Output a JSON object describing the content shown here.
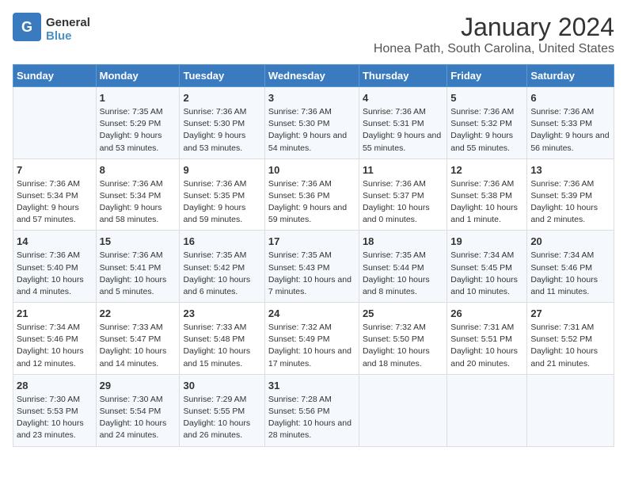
{
  "logo": {
    "line1": "General",
    "line2": "Blue"
  },
  "title": "January 2024",
  "subtitle": "Honea Path, South Carolina, United States",
  "weekdays": [
    "Sunday",
    "Monday",
    "Tuesday",
    "Wednesday",
    "Thursday",
    "Friday",
    "Saturday"
  ],
  "weeks": [
    [
      {
        "day": "",
        "sunrise": "",
        "sunset": "",
        "daylight": ""
      },
      {
        "day": "1",
        "sunrise": "Sunrise: 7:35 AM",
        "sunset": "Sunset: 5:29 PM",
        "daylight": "Daylight: 9 hours and 53 minutes."
      },
      {
        "day": "2",
        "sunrise": "Sunrise: 7:36 AM",
        "sunset": "Sunset: 5:30 PM",
        "daylight": "Daylight: 9 hours and 53 minutes."
      },
      {
        "day": "3",
        "sunrise": "Sunrise: 7:36 AM",
        "sunset": "Sunset: 5:30 PM",
        "daylight": "Daylight: 9 hours and 54 minutes."
      },
      {
        "day": "4",
        "sunrise": "Sunrise: 7:36 AM",
        "sunset": "Sunset: 5:31 PM",
        "daylight": "Daylight: 9 hours and 55 minutes."
      },
      {
        "day": "5",
        "sunrise": "Sunrise: 7:36 AM",
        "sunset": "Sunset: 5:32 PM",
        "daylight": "Daylight: 9 hours and 55 minutes."
      },
      {
        "day": "6",
        "sunrise": "Sunrise: 7:36 AM",
        "sunset": "Sunset: 5:33 PM",
        "daylight": "Daylight: 9 hours and 56 minutes."
      }
    ],
    [
      {
        "day": "7",
        "sunrise": "Sunrise: 7:36 AM",
        "sunset": "Sunset: 5:34 PM",
        "daylight": "Daylight: 9 hours and 57 minutes."
      },
      {
        "day": "8",
        "sunrise": "Sunrise: 7:36 AM",
        "sunset": "Sunset: 5:34 PM",
        "daylight": "Daylight: 9 hours and 58 minutes."
      },
      {
        "day": "9",
        "sunrise": "Sunrise: 7:36 AM",
        "sunset": "Sunset: 5:35 PM",
        "daylight": "Daylight: 9 hours and 59 minutes."
      },
      {
        "day": "10",
        "sunrise": "Sunrise: 7:36 AM",
        "sunset": "Sunset: 5:36 PM",
        "daylight": "Daylight: 9 hours and 59 minutes."
      },
      {
        "day": "11",
        "sunrise": "Sunrise: 7:36 AM",
        "sunset": "Sunset: 5:37 PM",
        "daylight": "Daylight: 10 hours and 0 minutes."
      },
      {
        "day": "12",
        "sunrise": "Sunrise: 7:36 AM",
        "sunset": "Sunset: 5:38 PM",
        "daylight": "Daylight: 10 hours and 1 minute."
      },
      {
        "day": "13",
        "sunrise": "Sunrise: 7:36 AM",
        "sunset": "Sunset: 5:39 PM",
        "daylight": "Daylight: 10 hours and 2 minutes."
      }
    ],
    [
      {
        "day": "14",
        "sunrise": "Sunrise: 7:36 AM",
        "sunset": "Sunset: 5:40 PM",
        "daylight": "Daylight: 10 hours and 4 minutes."
      },
      {
        "day": "15",
        "sunrise": "Sunrise: 7:36 AM",
        "sunset": "Sunset: 5:41 PM",
        "daylight": "Daylight: 10 hours and 5 minutes."
      },
      {
        "day": "16",
        "sunrise": "Sunrise: 7:35 AM",
        "sunset": "Sunset: 5:42 PM",
        "daylight": "Daylight: 10 hours and 6 minutes."
      },
      {
        "day": "17",
        "sunrise": "Sunrise: 7:35 AM",
        "sunset": "Sunset: 5:43 PM",
        "daylight": "Daylight: 10 hours and 7 minutes."
      },
      {
        "day": "18",
        "sunrise": "Sunrise: 7:35 AM",
        "sunset": "Sunset: 5:44 PM",
        "daylight": "Daylight: 10 hours and 8 minutes."
      },
      {
        "day": "19",
        "sunrise": "Sunrise: 7:34 AM",
        "sunset": "Sunset: 5:45 PM",
        "daylight": "Daylight: 10 hours and 10 minutes."
      },
      {
        "day": "20",
        "sunrise": "Sunrise: 7:34 AM",
        "sunset": "Sunset: 5:46 PM",
        "daylight": "Daylight: 10 hours and 11 minutes."
      }
    ],
    [
      {
        "day": "21",
        "sunrise": "Sunrise: 7:34 AM",
        "sunset": "Sunset: 5:46 PM",
        "daylight": "Daylight: 10 hours and 12 minutes."
      },
      {
        "day": "22",
        "sunrise": "Sunrise: 7:33 AM",
        "sunset": "Sunset: 5:47 PM",
        "daylight": "Daylight: 10 hours and 14 minutes."
      },
      {
        "day": "23",
        "sunrise": "Sunrise: 7:33 AM",
        "sunset": "Sunset: 5:48 PM",
        "daylight": "Daylight: 10 hours and 15 minutes."
      },
      {
        "day": "24",
        "sunrise": "Sunrise: 7:32 AM",
        "sunset": "Sunset: 5:49 PM",
        "daylight": "Daylight: 10 hours and 17 minutes."
      },
      {
        "day": "25",
        "sunrise": "Sunrise: 7:32 AM",
        "sunset": "Sunset: 5:50 PM",
        "daylight": "Daylight: 10 hours and 18 minutes."
      },
      {
        "day": "26",
        "sunrise": "Sunrise: 7:31 AM",
        "sunset": "Sunset: 5:51 PM",
        "daylight": "Daylight: 10 hours and 20 minutes."
      },
      {
        "day": "27",
        "sunrise": "Sunrise: 7:31 AM",
        "sunset": "Sunset: 5:52 PM",
        "daylight": "Daylight: 10 hours and 21 minutes."
      }
    ],
    [
      {
        "day": "28",
        "sunrise": "Sunrise: 7:30 AM",
        "sunset": "Sunset: 5:53 PM",
        "daylight": "Daylight: 10 hours and 23 minutes."
      },
      {
        "day": "29",
        "sunrise": "Sunrise: 7:30 AM",
        "sunset": "Sunset: 5:54 PM",
        "daylight": "Daylight: 10 hours and 24 minutes."
      },
      {
        "day": "30",
        "sunrise": "Sunrise: 7:29 AM",
        "sunset": "Sunset: 5:55 PM",
        "daylight": "Daylight: 10 hours and 26 minutes."
      },
      {
        "day": "31",
        "sunrise": "Sunrise: 7:28 AM",
        "sunset": "Sunset: 5:56 PM",
        "daylight": "Daylight: 10 hours and 28 minutes."
      },
      {
        "day": "",
        "sunrise": "",
        "sunset": "",
        "daylight": ""
      },
      {
        "day": "",
        "sunrise": "",
        "sunset": "",
        "daylight": ""
      },
      {
        "day": "",
        "sunrise": "",
        "sunset": "",
        "daylight": ""
      }
    ]
  ]
}
